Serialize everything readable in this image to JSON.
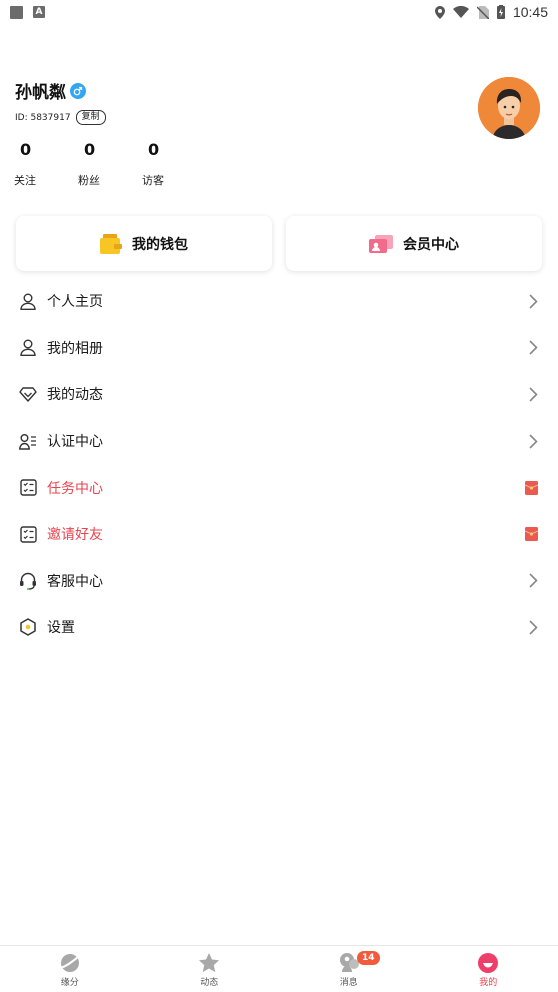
{
  "status_bar": {
    "time": "10:45",
    "left_icons": [
      "square-icon",
      "a-icon"
    ],
    "right_icons": [
      "location-icon",
      "wifi-icon",
      "no-sim-icon",
      "battery-charging-icon"
    ]
  },
  "profile": {
    "username": "孙帆粼",
    "gender_icon": "male-icon",
    "id_text": "ID: 5837917",
    "copy_label": "复制",
    "stats": [
      {
        "value": "0",
        "label": "关注"
      },
      {
        "value": "0",
        "label": "粉丝"
      },
      {
        "value": "0",
        "label": "访客"
      }
    ]
  },
  "cards": {
    "wallet": {
      "label": "我的钱包",
      "icon": "wallet-icon",
      "color": "#f7c624"
    },
    "vip": {
      "label": "会员中心",
      "icon": "vip-icon",
      "color": "#f26b8c"
    }
  },
  "menu": [
    {
      "label": "个人主页",
      "icon": "user-icon",
      "right": "chevron-right-icon"
    },
    {
      "label": "我的相册",
      "icon": "user-icon",
      "right": "chevron-right-icon"
    },
    {
      "label": "我的动态",
      "icon": "diamond-icon",
      "right": "chevron-right-icon"
    },
    {
      "label": "认证中心",
      "icon": "user-list-icon",
      "right": "chevron-right-icon"
    },
    {
      "label": "任务中心",
      "icon": "checklist-icon",
      "right": "red-packet-icon",
      "highlight": true
    },
    {
      "label": "邀请好友",
      "icon": "checklist-icon",
      "right": "red-packet-icon",
      "highlight": true
    },
    {
      "label": "客服中心",
      "icon": "headset-icon",
      "right": "chevron-right-icon"
    },
    {
      "label": "设置",
      "icon": "hexagon-settings-icon",
      "right": "chevron-right-icon"
    }
  ],
  "bottom_nav": [
    {
      "label": "缘分",
      "icon": "planet-icon"
    },
    {
      "label": "动态",
      "icon": "star-icon"
    },
    {
      "label": "消息",
      "icon": "message-icon",
      "badge": "14"
    },
    {
      "label": "我的",
      "icon": "profile-active-icon",
      "active": true
    }
  ],
  "colors": {
    "accent": "#e8454f",
    "badge": "#f25a3e",
    "gender": "#33a5f2"
  }
}
